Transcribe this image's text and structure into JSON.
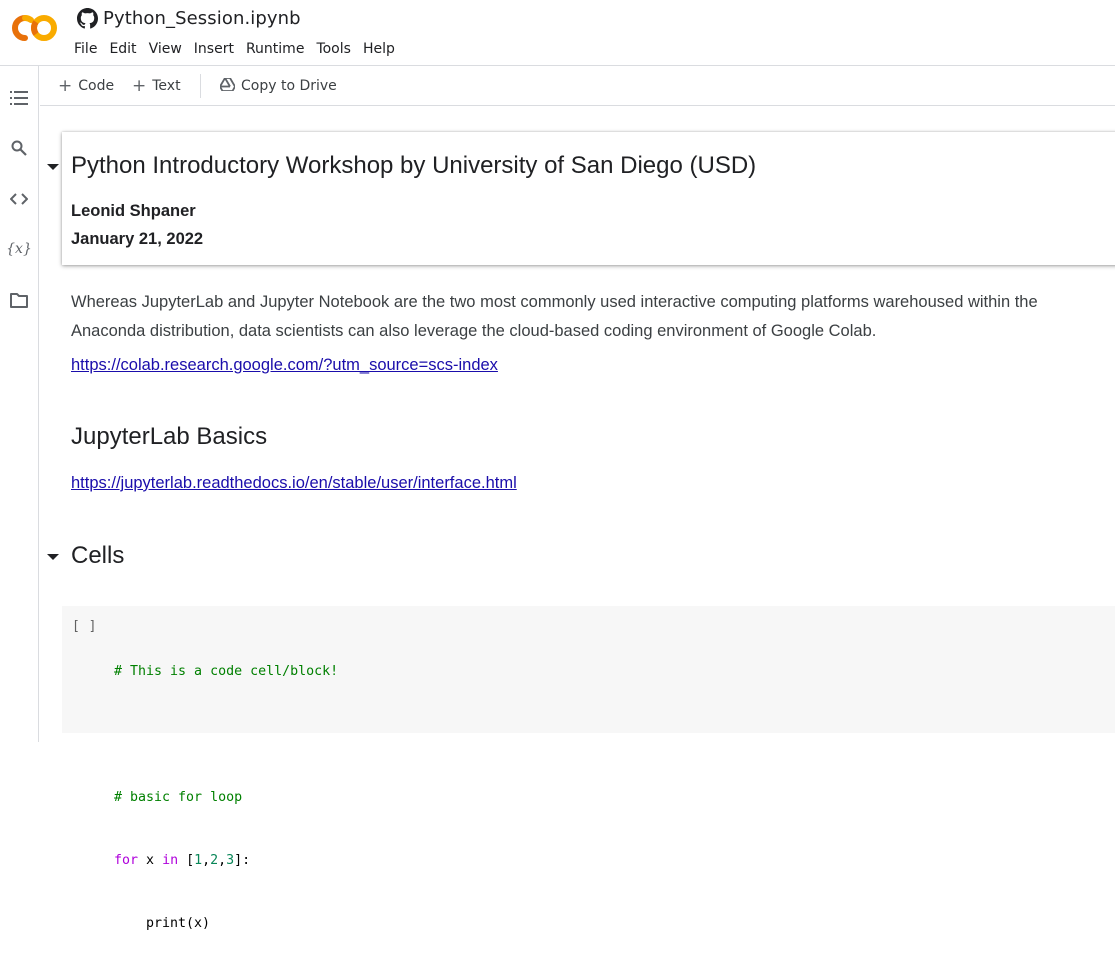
{
  "app": {
    "logo_text": "CO",
    "notebook_title": "Python_Session.ipynb",
    "menu": [
      "File",
      "Edit",
      "View",
      "Insert",
      "Runtime",
      "Tools",
      "Help"
    ]
  },
  "toolbar": {
    "code_label": "Code",
    "text_label": "Text",
    "copy_label": "Copy to Drive"
  },
  "sidebar": {
    "icons": [
      "table-of-contents-icon",
      "search-icon",
      "code-snippets-icon",
      "variables-icon",
      "files-icon"
    ],
    "variables_glyph": "{x}"
  },
  "notebook": {
    "title_cell": {
      "heading": "Python Introductory Workshop by University of San Diego (USD)",
      "author": "Leonid Shpaner",
      "date": "January 21, 2022"
    },
    "intro_line1": "Whereas JupyterLab and Jupyter Notebook are the two most commonly used interactive computing platforms warehoused within the",
    "intro_line2": "Anaconda distribution, data scientists can also leverage the cloud-based coding environment of Google Colab.",
    "colab_link": "https://colab.research.google.com/?utm_source=scs-index",
    "section_basics": "JupyterLab Basics",
    "basics_link": "https://jupyterlab.readthedocs.io/en/stable/user/interface.html",
    "section_cells": "Cells",
    "code_cell": {
      "run_indicator": "[ ]",
      "line1": "# This is a code cell/block!",
      "line2": "",
      "line3": "# basic for loop",
      "line4_kw_for": "for",
      "line4_x": " x ",
      "line4_kw_in": "in",
      "line4_open": " [",
      "line4_n1": "1",
      "line4_c1": ",",
      "line4_n2": "2",
      "line4_c2": ",",
      "line4_n3": "3",
      "line4_close": "]:",
      "line5": "    print(x)"
    }
  },
  "colors": {
    "logo_orange": "#F9AB00",
    "logo_dark_orange": "#E8710A",
    "link": "#1a0dab",
    "comment": "#008000",
    "keyword": "#af00db",
    "number": "#098658"
  }
}
